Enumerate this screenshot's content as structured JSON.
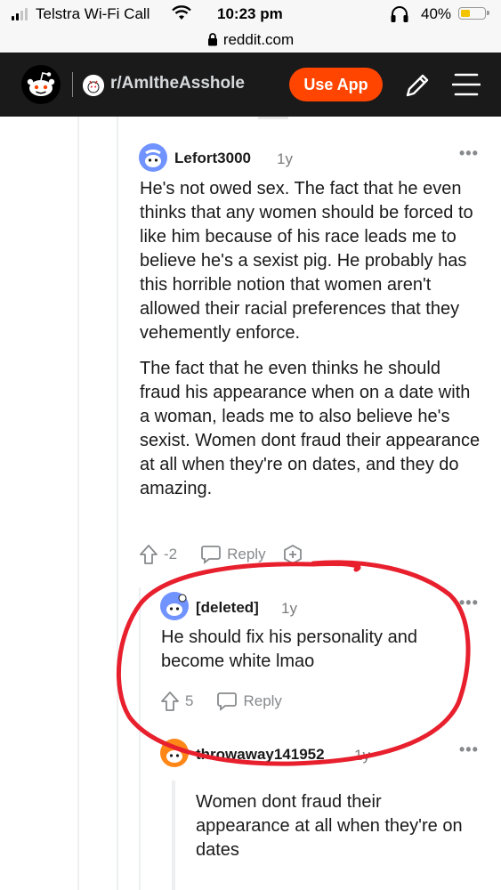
{
  "status_bar": {
    "carrier": "Telstra Wi-Fi Call",
    "time": "10:23 pm",
    "battery_percent": "40%",
    "battery_level": 0.4,
    "battery_color": "#f5c400"
  },
  "browser": {
    "url": "reddit.com",
    "lock_icon": "lock-icon"
  },
  "header": {
    "subreddit": "r/AmItheAsshole",
    "use_app_label": "Use App",
    "brand_color": "#ff4500",
    "icons": [
      "reddit-logo-icon",
      "pencil-icon",
      "hamburger-menu-icon"
    ]
  },
  "comments": [
    {
      "username": "Lefort3000",
      "age": "1y",
      "paragraphs": [
        "He's not owed sex. The fact that he even thinks that any women should be forced to like him because of his race leads me to believe he's a sexist pig. He probably has this horrible notion that women aren't allowed their racial preferences that they vehemently enforce.",
        "The fact that he even thinks he should fraud his appearance when on a date with a woman, leads me to also believe he's sexist. Women dont fraud their appearance at all when they're on dates, and they do amazing."
      ],
      "score": "-2",
      "reply_label": "Reply"
    },
    {
      "username": "[deleted]",
      "age": "1y",
      "paragraphs": [
        "He should fix his personality and become white lmao"
      ],
      "score": "5",
      "reply_label": "Reply"
    },
    {
      "username": "throwaway141952",
      "age": "1y",
      "quote": "Women dont fraud their appearance at all when they're on dates"
    }
  ],
  "annotation_color": "#e8202e"
}
